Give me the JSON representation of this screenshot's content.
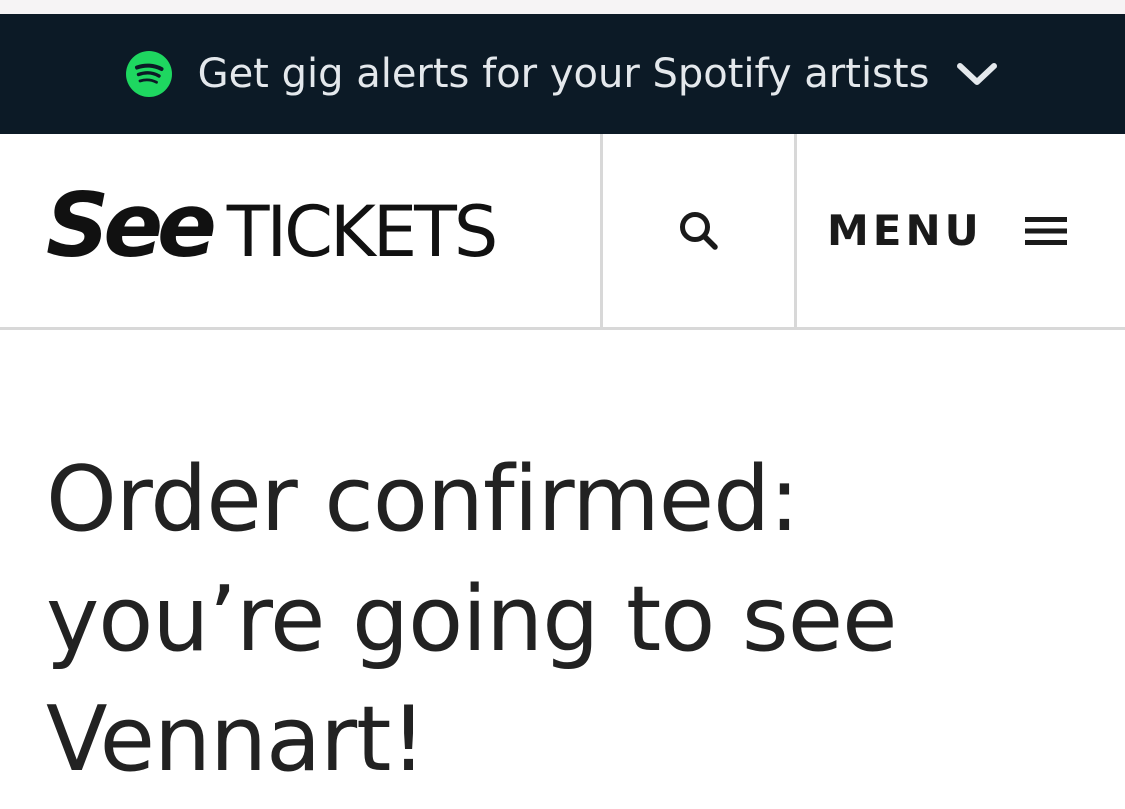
{
  "banner": {
    "text": "Get gig alerts for your Spotify artists",
    "icon": "spotify-icon",
    "expand_icon": "chevron-down-icon",
    "background": "#0c1a26",
    "logo_color": "#1ed760"
  },
  "header": {
    "logo_see": "See",
    "logo_tickets": "TICKETS",
    "search_icon": "search-icon",
    "menu_label": "MENU",
    "menu_icon": "hamburger-icon"
  },
  "main": {
    "headline_lines": [
      "Order confirmed:",
      "you’re going to see",
      "Vennart!"
    ]
  }
}
